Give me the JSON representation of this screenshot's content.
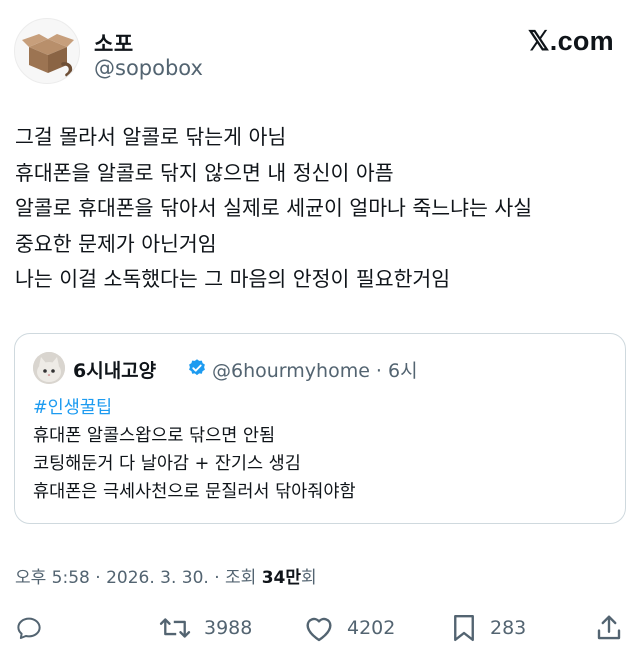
{
  "author": {
    "display_name": "소포",
    "handle": "@sopobox",
    "avatar_icon": "cardboard-box-cat-icon"
  },
  "site_logo": "𝕏.com",
  "tweet": {
    "lines": [
      "그걸 몰라서 알콜로 닦는게 아님",
      "휴대폰을 알콜로 닦지 않으면 내 정신이 아픔",
      "알콜로 휴대폰을 닦아서 실제로 세균이 얼마나 죽느냐는 사실",
      "중요한 문제가 아닌거임",
      "나는 이걸 소독했다는 그 마음의 안정이 필요한거임"
    ]
  },
  "quote": {
    "display_name": "6시내고양",
    "verified_icon": "verified-badge-icon",
    "handle_time": "@6hourmyhome · 6시",
    "hashtag": "#인생꿀팁",
    "lines": [
      "휴대폰 알콜스왑으로 닦으면 안됨",
      "코팅해둔거 다 날아감 + 잔기스 생김",
      "휴대폰은 극세사천으로 문질러서 닦아줘야함"
    ]
  },
  "meta": {
    "time_date": "오후 5:58 · 2026. 3. 30. · 조회 ",
    "views": "34만",
    "views_suffix": "회"
  },
  "actions": {
    "reply_count": "",
    "retweet_count": "3988",
    "like_count": "4202",
    "bookmark_count": "283"
  },
  "colors": {
    "text": "#0f1419",
    "secondary": "#536471",
    "link": "#1d9bf0",
    "border": "#cfd9de"
  }
}
